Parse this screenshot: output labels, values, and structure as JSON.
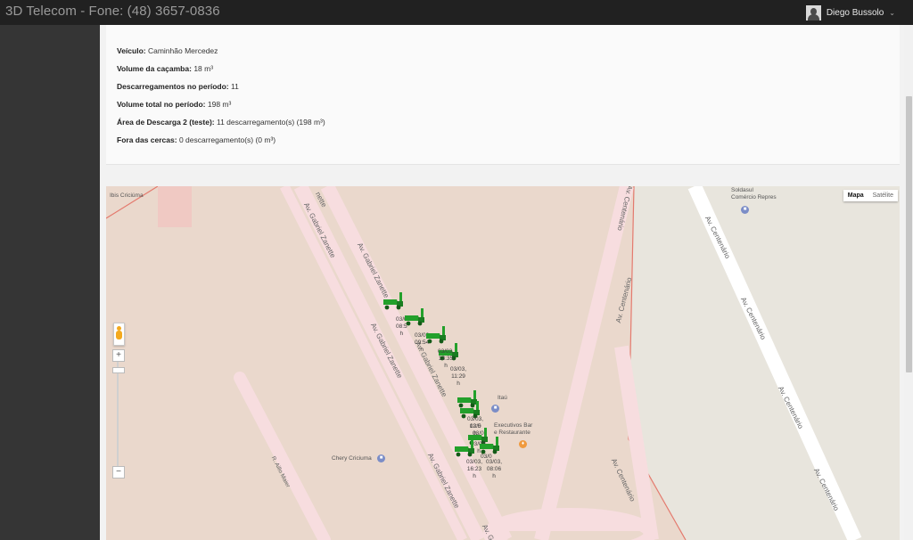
{
  "app": {
    "title": "3D Telecom - Fone: (48) 3657-0836"
  },
  "user": {
    "name": "Diego Bussolo"
  },
  "info": {
    "veiculo_label": "Veículo:",
    "veiculo_value": "Caminhão Mercedez",
    "volume_label": "Volume da caçamba:",
    "volume_value": "18 m³",
    "descarreg_label": "Descarregamentos no período:",
    "descarreg_value": "11",
    "total_label": "Volume total no período:",
    "total_value": "198 m³",
    "area_label": "Área de Descarga 2 (teste):",
    "area_value": "11 descarregamento(s) (198 m³)",
    "fora_label": "Fora das cercas:",
    "fora_value": "0 descarregamento(s) (0 m³)"
  },
  "map": {
    "type_active": "Mapa",
    "type_inactive": "Satélite",
    "zoom_in": "+",
    "zoom_out": "−",
    "streets": {
      "gz1": "Av. Gabriel Zanette",
      "gz2": "Av. Gabriel Zanette",
      "gz3": "Av. Gabriel Zanette",
      "gz4": "Av. Gabriel Zanette",
      "gz5": "Av. Gabriel Zanette",
      "gz6": "nette",
      "gz7": "Av. G",
      "ac1": "Av. Centenário",
      "ac2": "Av. Centenário",
      "ac3": "Av. Centenário",
      "ac4": "Av. Centenário",
      "ac5": "Av. Centenário",
      "ac6": "Av. Centenário",
      "ac7": "Av. Centenário",
      "aillo": "R. Aillo Maier"
    },
    "pois": {
      "ibis": "Ibis Criciúma",
      "soldasul1": "Soldasul",
      "soldasul2": "Comércio Repres",
      "itau": "Itaú",
      "exec1": "Executivos Bar",
      "exec2": "e Restaurante",
      "chery": "Chery Criciuma"
    },
    "markers": [
      {
        "label": "03/0\n08:5\nh"
      },
      {
        "label": "03/03\n09:54\nh"
      },
      {
        "label": "03/03,\n11:29\nh"
      },
      {
        "label": "03/03,\n13:35\nh"
      },
      {
        "label": "03/03,\n12:5\nh"
      },
      {
        "label": "03/03,\nh"
      },
      {
        "label": "03/03,\n16:23\nh"
      },
      {
        "label": "03/03,\n08:06\nh"
      },
      {
        "label": "03/0"
      },
      {
        "label": "03/0"
      },
      {
        "label": "03/0"
      }
    ]
  },
  "colors": {
    "topbar": "#212121",
    "sidebar": "#353535",
    "map_land": "#ead8cc",
    "road": "#f7dddf",
    "park": "#e8e5dd",
    "truck": "#23a02b"
  }
}
